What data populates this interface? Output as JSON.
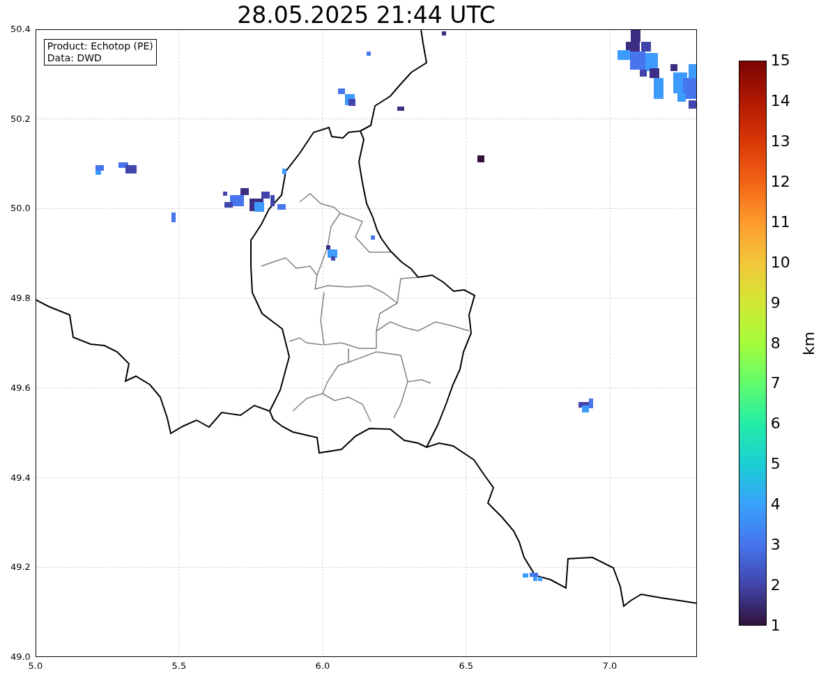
{
  "title": "28.05.2025 21:44 UTC",
  "info_box": [
    "Product: Echotop (PE)",
    "Data: DWD"
  ],
  "axes": {
    "y_ticks": [
      "50.4",
      "50.2",
      "50.0",
      "49.8",
      "49.6",
      "49.4",
      "49.2",
      "49.0"
    ],
    "x_ticks": [
      "5.0",
      "5.5",
      "6.0",
      "6.5",
      "7.0"
    ]
  },
  "colorbar": {
    "label": "km",
    "ticks": [
      "15",
      "14",
      "13",
      "12",
      "11",
      "10",
      "9",
      "8",
      "7",
      "6",
      "5",
      "4",
      "3",
      "2",
      "1"
    ]
  }
}
